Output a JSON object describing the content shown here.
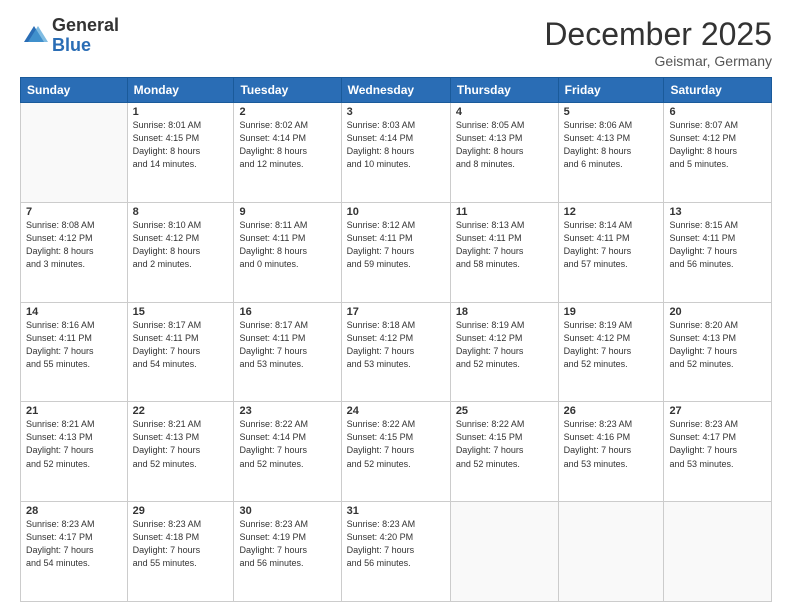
{
  "header": {
    "logo_general": "General",
    "logo_blue": "Blue",
    "month_title": "December 2025",
    "location": "Geismar, Germany"
  },
  "weekdays": [
    "Sunday",
    "Monday",
    "Tuesday",
    "Wednesday",
    "Thursday",
    "Friday",
    "Saturday"
  ],
  "weeks": [
    [
      {
        "day": "",
        "info": ""
      },
      {
        "day": "1",
        "info": "Sunrise: 8:01 AM\nSunset: 4:15 PM\nDaylight: 8 hours\nand 14 minutes."
      },
      {
        "day": "2",
        "info": "Sunrise: 8:02 AM\nSunset: 4:14 PM\nDaylight: 8 hours\nand 12 minutes."
      },
      {
        "day": "3",
        "info": "Sunrise: 8:03 AM\nSunset: 4:14 PM\nDaylight: 8 hours\nand 10 minutes."
      },
      {
        "day": "4",
        "info": "Sunrise: 8:05 AM\nSunset: 4:13 PM\nDaylight: 8 hours\nand 8 minutes."
      },
      {
        "day": "5",
        "info": "Sunrise: 8:06 AM\nSunset: 4:13 PM\nDaylight: 8 hours\nand 6 minutes."
      },
      {
        "day": "6",
        "info": "Sunrise: 8:07 AM\nSunset: 4:12 PM\nDaylight: 8 hours\nand 5 minutes."
      }
    ],
    [
      {
        "day": "7",
        "info": "Sunrise: 8:08 AM\nSunset: 4:12 PM\nDaylight: 8 hours\nand 3 minutes."
      },
      {
        "day": "8",
        "info": "Sunrise: 8:10 AM\nSunset: 4:12 PM\nDaylight: 8 hours\nand 2 minutes."
      },
      {
        "day": "9",
        "info": "Sunrise: 8:11 AM\nSunset: 4:11 PM\nDaylight: 8 hours\nand 0 minutes."
      },
      {
        "day": "10",
        "info": "Sunrise: 8:12 AM\nSunset: 4:11 PM\nDaylight: 7 hours\nand 59 minutes."
      },
      {
        "day": "11",
        "info": "Sunrise: 8:13 AM\nSunset: 4:11 PM\nDaylight: 7 hours\nand 58 minutes."
      },
      {
        "day": "12",
        "info": "Sunrise: 8:14 AM\nSunset: 4:11 PM\nDaylight: 7 hours\nand 57 minutes."
      },
      {
        "day": "13",
        "info": "Sunrise: 8:15 AM\nSunset: 4:11 PM\nDaylight: 7 hours\nand 56 minutes."
      }
    ],
    [
      {
        "day": "14",
        "info": "Sunrise: 8:16 AM\nSunset: 4:11 PM\nDaylight: 7 hours\nand 55 minutes."
      },
      {
        "day": "15",
        "info": "Sunrise: 8:17 AM\nSunset: 4:11 PM\nDaylight: 7 hours\nand 54 minutes."
      },
      {
        "day": "16",
        "info": "Sunrise: 8:17 AM\nSunset: 4:11 PM\nDaylight: 7 hours\nand 53 minutes."
      },
      {
        "day": "17",
        "info": "Sunrise: 8:18 AM\nSunset: 4:12 PM\nDaylight: 7 hours\nand 53 minutes."
      },
      {
        "day": "18",
        "info": "Sunrise: 8:19 AM\nSunset: 4:12 PM\nDaylight: 7 hours\nand 52 minutes."
      },
      {
        "day": "19",
        "info": "Sunrise: 8:19 AM\nSunset: 4:12 PM\nDaylight: 7 hours\nand 52 minutes."
      },
      {
        "day": "20",
        "info": "Sunrise: 8:20 AM\nSunset: 4:13 PM\nDaylight: 7 hours\nand 52 minutes."
      }
    ],
    [
      {
        "day": "21",
        "info": "Sunrise: 8:21 AM\nSunset: 4:13 PM\nDaylight: 7 hours\nand 52 minutes."
      },
      {
        "day": "22",
        "info": "Sunrise: 8:21 AM\nSunset: 4:13 PM\nDaylight: 7 hours\nand 52 minutes."
      },
      {
        "day": "23",
        "info": "Sunrise: 8:22 AM\nSunset: 4:14 PM\nDaylight: 7 hours\nand 52 minutes."
      },
      {
        "day": "24",
        "info": "Sunrise: 8:22 AM\nSunset: 4:15 PM\nDaylight: 7 hours\nand 52 minutes."
      },
      {
        "day": "25",
        "info": "Sunrise: 8:22 AM\nSunset: 4:15 PM\nDaylight: 7 hours\nand 52 minutes."
      },
      {
        "day": "26",
        "info": "Sunrise: 8:23 AM\nSunset: 4:16 PM\nDaylight: 7 hours\nand 53 minutes."
      },
      {
        "day": "27",
        "info": "Sunrise: 8:23 AM\nSunset: 4:17 PM\nDaylight: 7 hours\nand 53 minutes."
      }
    ],
    [
      {
        "day": "28",
        "info": "Sunrise: 8:23 AM\nSunset: 4:17 PM\nDaylight: 7 hours\nand 54 minutes."
      },
      {
        "day": "29",
        "info": "Sunrise: 8:23 AM\nSunset: 4:18 PM\nDaylight: 7 hours\nand 55 minutes."
      },
      {
        "day": "30",
        "info": "Sunrise: 8:23 AM\nSunset: 4:19 PM\nDaylight: 7 hours\nand 56 minutes."
      },
      {
        "day": "31",
        "info": "Sunrise: 8:23 AM\nSunset: 4:20 PM\nDaylight: 7 hours\nand 56 minutes."
      },
      {
        "day": "",
        "info": ""
      },
      {
        "day": "",
        "info": ""
      },
      {
        "day": "",
        "info": ""
      }
    ]
  ]
}
